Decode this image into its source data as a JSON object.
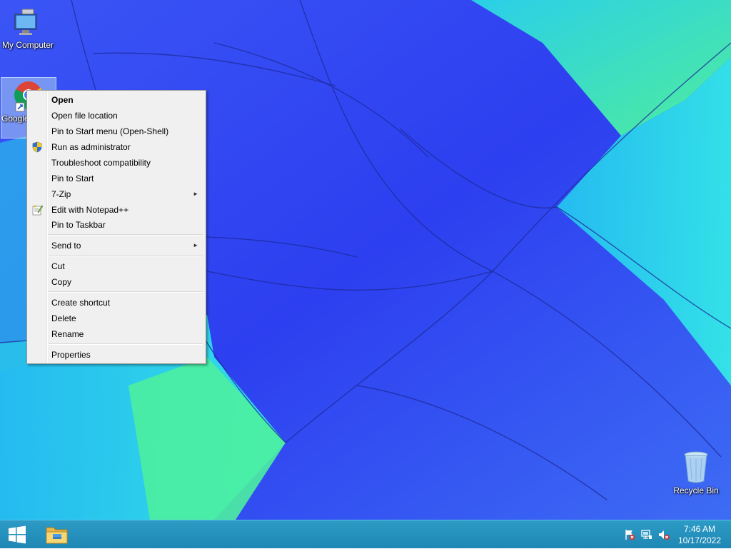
{
  "desktop": {
    "icons": [
      {
        "label": "My Computer",
        "icon": "computer-icon"
      },
      {
        "label": "Google Chrome",
        "label_visible": "Goo\nChr",
        "icon": "chrome-icon"
      },
      {
        "label": "Recycle Bin",
        "icon": "recycle-bin-icon"
      }
    ]
  },
  "context_menu": {
    "items": [
      {
        "label": "Open",
        "default": true
      },
      {
        "label": "Open file location"
      },
      {
        "label": "Pin to Start menu (Open-Shell)"
      },
      {
        "label": "Run as administrator",
        "icon": "uac-shield-icon"
      },
      {
        "label": "Troubleshoot compatibility"
      },
      {
        "label": "Pin to Start"
      },
      {
        "label": "7-Zip",
        "submenu": true
      },
      {
        "label": "Edit with Notepad++",
        "icon": "notepadpp-icon"
      },
      {
        "label": "Pin to Taskbar"
      },
      {
        "label": "Send to",
        "submenu": true
      },
      {
        "label": "Cut"
      },
      {
        "label": "Copy"
      },
      {
        "label": "Create shortcut"
      },
      {
        "label": "Delete"
      },
      {
        "label": "Rename"
      },
      {
        "label": "Properties"
      }
    ],
    "submenu_arrow": "►"
  },
  "taskbar": {
    "start_icon": "windows-logo-icon",
    "pinned": [
      "file-explorer-icon"
    ],
    "tray_icons": [
      "action-center-flag-icon",
      "network-icon",
      "volume-muted-icon"
    ],
    "clock": {
      "time": "7:46 AM",
      "date": "10/17/2022"
    }
  },
  "colors": {
    "taskbar": "#1f87b3",
    "menu_bg": "#f0f0f0",
    "wallpaper_blue": "#2a4bf0",
    "wallpaper_cyan": "#28e0ee",
    "wallpaper_green": "#3cf2a0"
  }
}
